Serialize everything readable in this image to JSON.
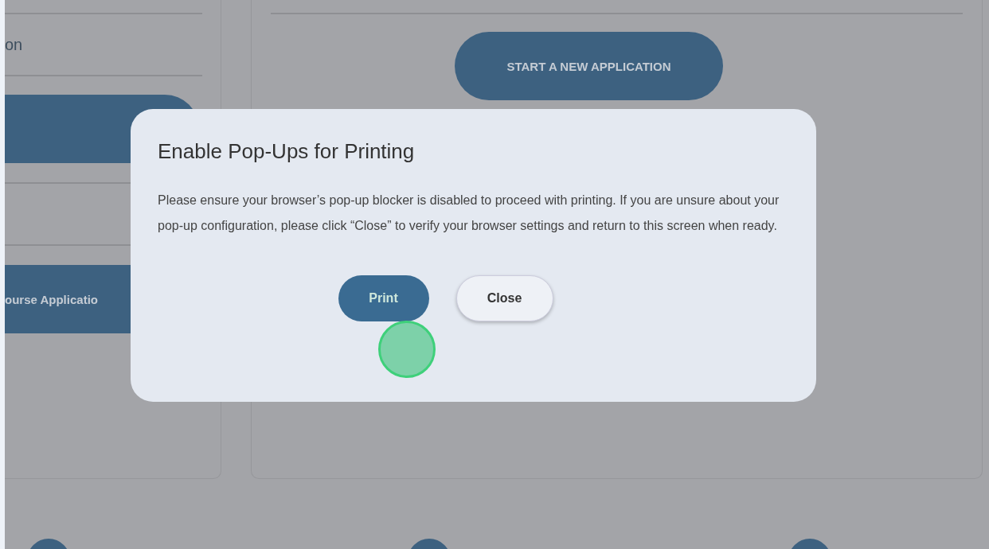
{
  "left_card": {
    "row_text": "on",
    "button_label": "ourse Applicatio"
  },
  "main_card": {
    "button_label": "START A NEW APPLICATION"
  },
  "dialog": {
    "title": "Enable Pop-Ups for Printing",
    "message": "Please ensure your browser’s pop-up blocker is disabled to proceed with printing. If you are unsure about your pop-up configuration, please click “Close” to verify your browser settings and return to this screen when ready.",
    "buttons": [
      {
        "label": "Print",
        "kind": "primary"
      },
      {
        "label": "Close",
        "kind": "secondary"
      }
    ]
  }
}
